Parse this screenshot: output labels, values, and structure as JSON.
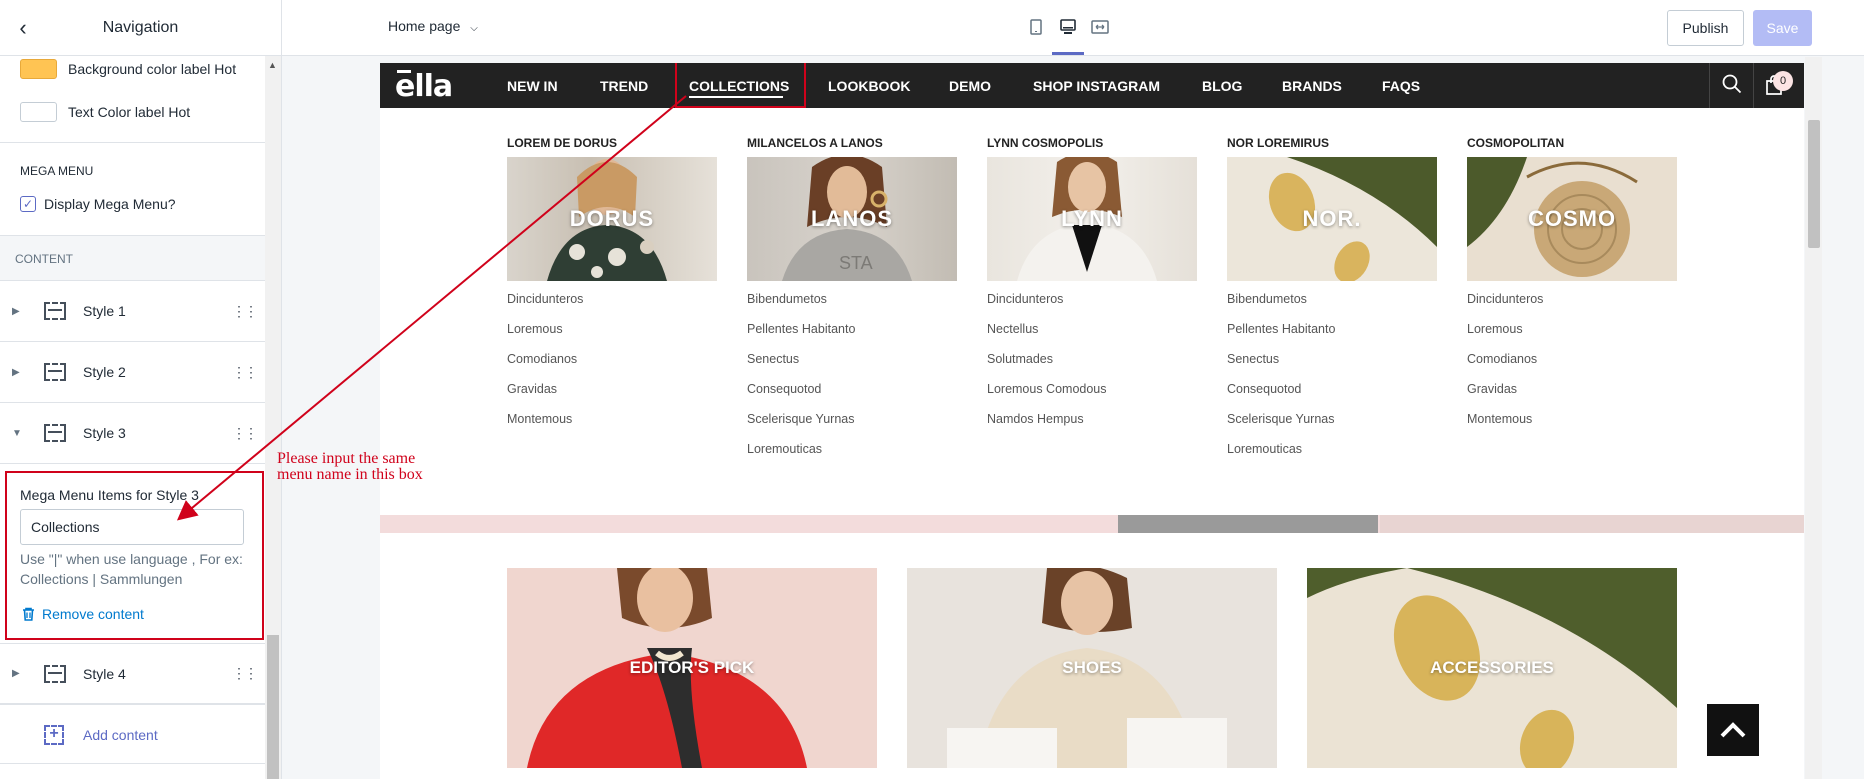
{
  "sidebar": {
    "title": "Navigation",
    "color_labels": [
      {
        "label": "Background color label Hot",
        "color": "#ffc453"
      },
      {
        "label": "Text Color label Hot",
        "color": "#ffffff"
      }
    ],
    "mega_menu_heading": "MEGA MENU",
    "display_mega_menu_label": "Display Mega Menu?",
    "display_mega_menu_checked": true,
    "content_heading": "CONTENT",
    "styles": [
      {
        "label": "Style 1",
        "expanded": false
      },
      {
        "label": "Style 2",
        "expanded": false
      },
      {
        "label": "Style 3",
        "expanded": true
      },
      {
        "label": "Style 4",
        "expanded": false
      }
    ],
    "panel": {
      "title": "Mega Menu Items for Style 3",
      "input_value": "Collections",
      "help_text": "Use \"|\" when use language , For ex: Collections | Sammlungen",
      "remove_label": "Remove content"
    },
    "add_content_label": "Add content"
  },
  "topbar": {
    "page_selector": "Home page",
    "devices": [
      "mobile-icon",
      "desktop-icon",
      "fullwidth-icon"
    ],
    "active_device": "desktop-icon",
    "publish_label": "Publish",
    "save_label": "Save"
  },
  "annotation": {
    "line1": "Please input the same",
    "line2": "menu name in this box"
  },
  "shop": {
    "logo": "ella",
    "nav": [
      "NEW IN",
      "TREND",
      "COLLECTIONS",
      "LOOKBOOK",
      "DEMO",
      "SHOP INSTAGRAM",
      "BLOG",
      "BRANDS",
      "FAQS"
    ],
    "active_nav": "COLLECTIONS",
    "cart_count": "0",
    "mega_columns": [
      {
        "title": "LOREM DE DORUS",
        "image_label": "DORUS",
        "links": [
          "Dincidunteros",
          "Loremous",
          "Comodianos",
          "Gravidas",
          "Montemous"
        ]
      },
      {
        "title": "MILANCELOS A LANOS",
        "image_label": "LANOS",
        "links": [
          "Bibendumetos",
          "Pellentes Habitanto",
          "Senectus",
          "Consequotod",
          "Scelerisque Yurnas",
          "Loremouticas"
        ]
      },
      {
        "title": "LYNN COSMOPOLIS",
        "image_label": "LYNN",
        "links": [
          "Dincidunteros",
          "Nectellus",
          "Solutmades",
          "Loremous Comodous",
          "Namdos Hempus"
        ]
      },
      {
        "title": "NOR LOREMIRUS",
        "image_label": "NOR.",
        "links": [
          "Bibendumetos",
          "Pellentes Habitanto",
          "Senectus",
          "Consequotod",
          "Scelerisque Yurnas",
          "Loremouticas"
        ]
      },
      {
        "title": "COSMOPOLITAN",
        "image_label": "COSMO",
        "links": [
          "Dincidunteros",
          "Loremous",
          "Comodianos",
          "Gravidas",
          "Montemous"
        ]
      }
    ],
    "banners": [
      "EDITOR'S PICK",
      "SHOES",
      "ACCESSORIES"
    ]
  },
  "colors": {
    "accent": "#5c6ac4",
    "annotation_red": "#d0021b",
    "nav_bg": "#222222"
  }
}
